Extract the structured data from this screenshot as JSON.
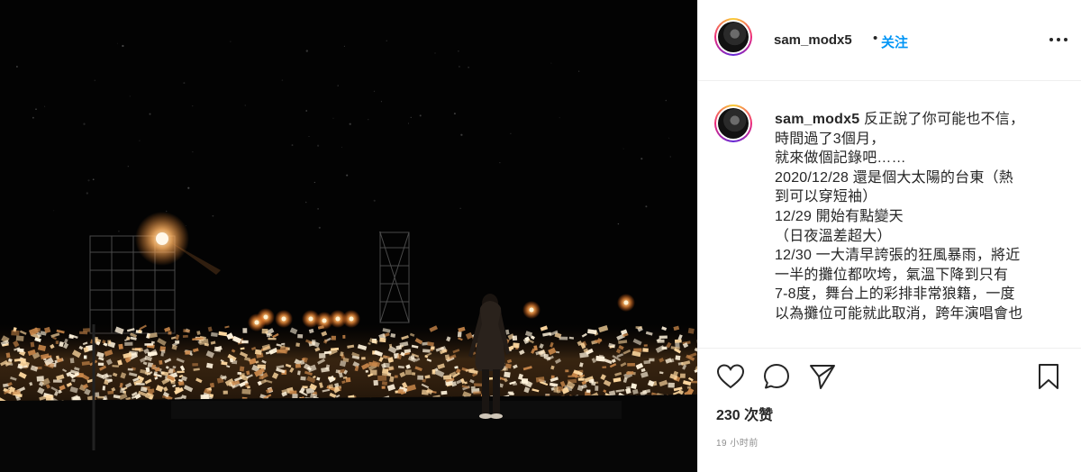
{
  "post": {
    "username": "sam_modx5",
    "separator": "•",
    "follow_label": "关注",
    "caption_username": "sam_modx5",
    "caption_lines": [
      "反正說了你可能也不信，",
      "時間過了3個月，",
      "就來做個記錄吧……",
      "2020/12/28 還是個大太陽的台東（熱",
      "到可以穿短袖）",
      "12/29 開始有點變天",
      "（日夜溫差超大）",
      "12/30 一大清早誇張的狂風暴雨，將近",
      "一半的攤位都吹垮，氣溫下降到只有",
      "7-8度，舞台上的彩排非常狼籍，一度",
      "以為攤位可能就此取消，跨年演唱會也"
    ],
    "likes_text": "230 次赞",
    "timestamp": "19 小时前"
  },
  "icons": {
    "avatar": "user-avatar",
    "more": "more-options-icon",
    "like": "heart-icon",
    "comment": "comment-bubble-icon",
    "share": "paper-plane-icon",
    "save": "bookmark-icon"
  },
  "colors": {
    "follow_blue": "#0095f6",
    "text": "#262626",
    "muted": "#8e8e8e",
    "divider": "#efefef",
    "photo_bg": "#030303",
    "light_warm": "#ffd9a0"
  }
}
